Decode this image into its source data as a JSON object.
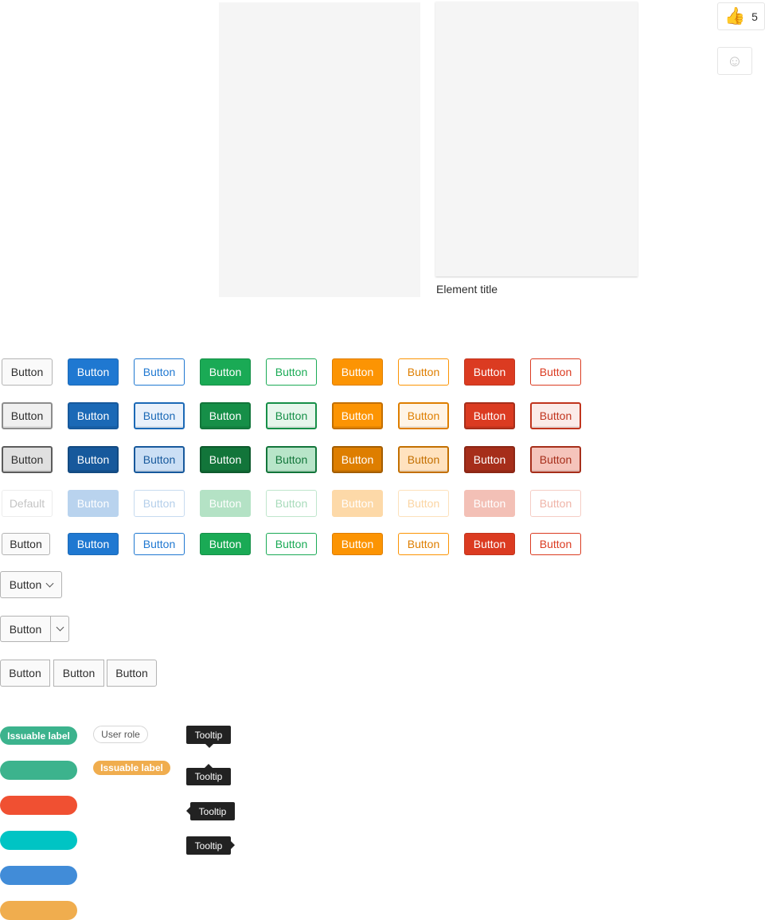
{
  "cards": {
    "element_title": "Element title"
  },
  "awards": {
    "thumbs_icon": "thumbs-up-icon",
    "thumbs_glyph": "👍",
    "count": "5",
    "smile_icon": "smile-icon",
    "smile_glyph": "☺"
  },
  "button_matrix": {
    "label": "Button",
    "disabled_default_label": "Default",
    "variants": [
      {
        "key": "default",
        "bg": "#fafafa",
        "border": "#b3b3b3",
        "text": "#2e2e2e"
      },
      {
        "key": "primary",
        "bg": "#1f78d1",
        "border": "#1b69b6",
        "text": "#ffffff"
      },
      {
        "key": "primary-outline",
        "bg": "#ffffff",
        "border": "#1f78d1",
        "text": "#1f78d1"
      },
      {
        "key": "success",
        "bg": "#1aaa55",
        "border": "#168f48",
        "text": "#ffffff"
      },
      {
        "key": "success-outline",
        "bg": "#ffffff",
        "border": "#1aaa55",
        "text": "#1aaa55"
      },
      {
        "key": "warning",
        "bg": "#fc9403",
        "border": "#de7e00",
        "text": "#ffffff"
      },
      {
        "key": "warning-outline",
        "bg": "#ffffff",
        "border": "#fc9403",
        "text": "#de7e00"
      },
      {
        "key": "danger",
        "bg": "#db3b21",
        "border": "#c0341d",
        "text": "#ffffff"
      },
      {
        "key": "danger-outline",
        "bg": "#ffffff",
        "border": "#db3b21",
        "text": "#db3b21"
      }
    ],
    "focus_variants": [
      {
        "bg": "#f0f0f0",
        "border": "#8c8c8c",
        "text": "#2e2e2e"
      },
      {
        "bg": "#1b69b6",
        "border": "#17599c",
        "text": "#ffffff"
      },
      {
        "bg": "#e9f1fb",
        "border": "#1b69b6",
        "text": "#1b69b6"
      },
      {
        "bg": "#168f48",
        "border": "#12753a",
        "text": "#ffffff"
      },
      {
        "bg": "#e6f6ec",
        "border": "#168f48",
        "text": "#168f48"
      },
      {
        "bg": "#fc9403",
        "border": "#c36f00",
        "text": "#ffffff"
      },
      {
        "bg": "#fff4e6",
        "border": "#de7e00",
        "text": "#de7e00"
      },
      {
        "bg": "#db3b21",
        "border": "#a62e1a",
        "text": "#ffffff"
      },
      {
        "bg": "#fbebe8",
        "border": "#c0341d",
        "text": "#c0341d"
      }
    ],
    "active_variants": [
      {
        "bg": "#e0e0e0",
        "border": "#5c5c5c",
        "text": "#2e2e2e"
      },
      {
        "bg": "#17599c",
        "border": "#134a81",
        "text": "#ffffff"
      },
      {
        "bg": "#cbdff5",
        "border": "#17599c",
        "text": "#17599c"
      },
      {
        "bg": "#12753a",
        "border": "#0e5a2d",
        "text": "#ffffff"
      },
      {
        "bg": "#b8e5c9",
        "border": "#12753a",
        "text": "#12753a"
      },
      {
        "bg": "#de7e00",
        "border": "#a35d00",
        "text": "#ffffff"
      },
      {
        "bg": "#ffe2bf",
        "border": "#c36f00",
        "text": "#c36f00"
      },
      {
        "bg": "#a62e1a",
        "border": "#8b2615",
        "text": "#ffffff"
      },
      {
        "bg": "#f5c4bb",
        "border": "#a62e1a",
        "text": "#a62e1a"
      }
    ],
    "disabled_variants": [
      {
        "bg": "#ffffff",
        "border": "#ececec",
        "text": "#c4c4c4"
      },
      {
        "bg": "#b9d3ee",
        "border": "#b9d3ee",
        "text": "#ffffff"
      },
      {
        "bg": "#ffffff",
        "border": "#c7dbf0",
        "text": "#b5cfea"
      },
      {
        "bg": "#b4e2c5",
        "border": "#b4e2c5",
        "text": "#ffffff"
      },
      {
        "bg": "#ffffff",
        "border": "#bfe6cc",
        "text": "#a8dbbb"
      },
      {
        "bg": "#fdd9a8",
        "border": "#fdd9a8",
        "text": "#ffffff"
      },
      {
        "bg": "#ffffff",
        "border": "#fde1bb",
        "text": "#fbd5a3"
      },
      {
        "bg": "#f3c0b6",
        "border": "#f3c0b6",
        "text": "#ffffff"
      },
      {
        "bg": "#ffffff",
        "border": "#f5cdc5",
        "text": "#efb4a8"
      }
    ]
  },
  "dropdowns": {
    "label": "Button"
  },
  "button_group": {
    "labels": [
      "Button",
      "Button",
      "Button"
    ]
  },
  "labels": {
    "issuable": "Issuable label",
    "user_role": "User role",
    "issuable_orange": "Issuable label",
    "green": "#3cb38d",
    "orange": "#f0ad4e",
    "swatches": [
      "#3cb38d",
      "#f05032",
      "#00c4c4",
      "#418cd8",
      "#f0ad4e"
    ]
  },
  "tooltips": {
    "items": [
      "Tooltip",
      "Tooltip",
      "Tooltip",
      "Tooltip"
    ]
  }
}
